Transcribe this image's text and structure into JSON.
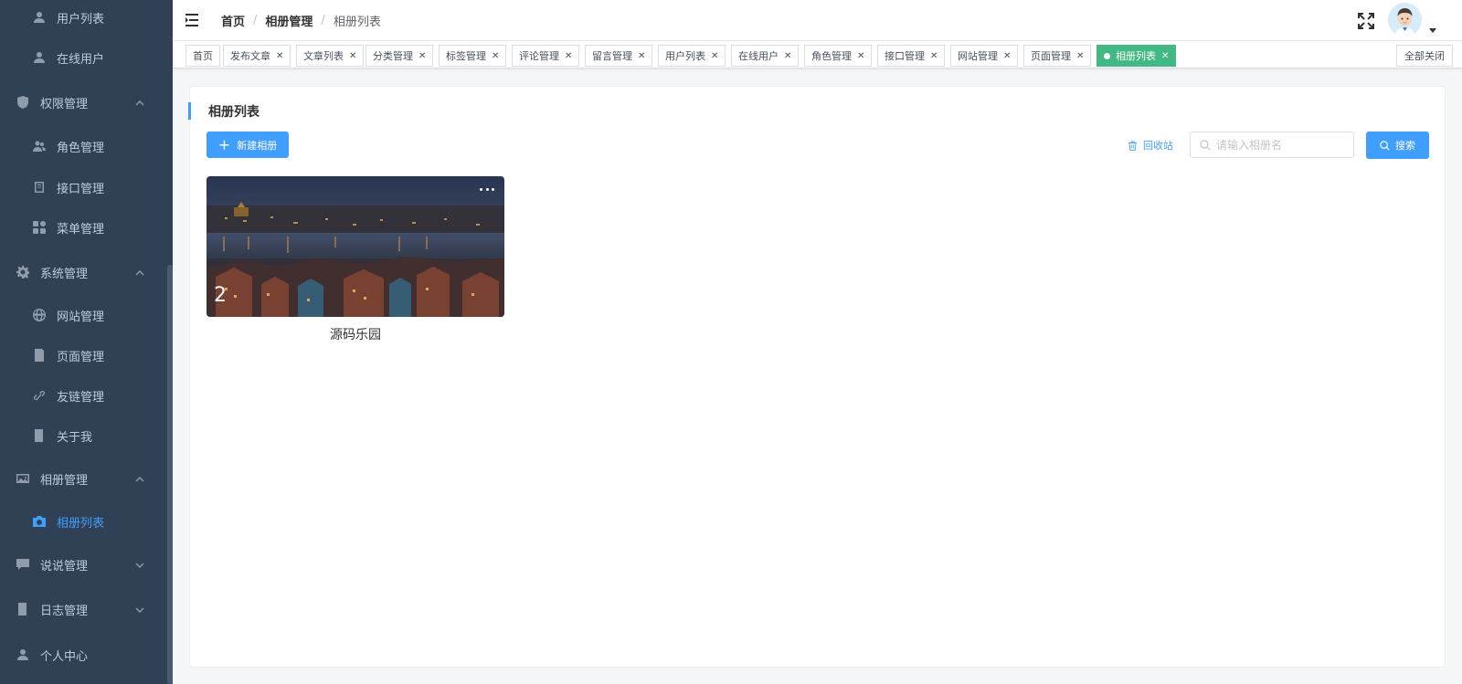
{
  "sidebar": {
    "items": [
      {
        "label": "用户列表",
        "icon": "user-icon",
        "level": "sub"
      },
      {
        "label": "在线用户",
        "icon": "user-icon",
        "level": "sub"
      },
      {
        "label": "权限管理",
        "icon": "shield-icon",
        "level": "top",
        "expanded": true
      },
      {
        "label": "角色管理",
        "icon": "users-icon",
        "level": "sub"
      },
      {
        "label": "接口管理",
        "icon": "api-icon",
        "level": "sub"
      },
      {
        "label": "菜单管理",
        "icon": "grid-icon",
        "level": "sub"
      },
      {
        "label": "系统管理",
        "icon": "gear-icon",
        "level": "top",
        "expanded": true
      },
      {
        "label": "网站管理",
        "icon": "globe-icon",
        "level": "sub"
      },
      {
        "label": "页面管理",
        "icon": "page-icon",
        "level": "sub"
      },
      {
        "label": "友链管理",
        "icon": "link-icon",
        "level": "sub"
      },
      {
        "label": "关于我",
        "icon": "book-icon",
        "level": "sub"
      },
      {
        "label": "相册管理",
        "icon": "image-icon",
        "level": "top",
        "expanded": true
      },
      {
        "label": "相册列表",
        "icon": "camera-icon",
        "level": "sub",
        "active": true
      },
      {
        "label": "说说管理",
        "icon": "chat-icon",
        "level": "top",
        "expanded": false
      },
      {
        "label": "日志管理",
        "icon": "log-icon",
        "level": "top",
        "expanded": false
      },
      {
        "label": "个人中心",
        "icon": "user-icon",
        "level": "top"
      }
    ]
  },
  "navbar": {
    "breadcrumb": [
      "首页",
      "相册管理",
      "相册列表"
    ],
    "separator": "/"
  },
  "tags": [
    {
      "label": "首页",
      "closable": false
    },
    {
      "label": "发布文章",
      "closable": true
    },
    {
      "label": "文章列表",
      "closable": true
    },
    {
      "label": "分类管理",
      "closable": true
    },
    {
      "label": "标签管理",
      "closable": true
    },
    {
      "label": "评论管理",
      "closable": true
    },
    {
      "label": "留言管理",
      "closable": true
    },
    {
      "label": "用户列表",
      "closable": true
    },
    {
      "label": "在线用户",
      "closable": true
    },
    {
      "label": "角色管理",
      "closable": true
    },
    {
      "label": "接口管理",
      "closable": true
    },
    {
      "label": "网站管理",
      "closable": true
    },
    {
      "label": "页面管理",
      "closable": true
    },
    {
      "label": "相册列表",
      "closable": true,
      "active": true
    }
  ],
  "tags_close_all": "全部关闭",
  "main": {
    "title": "相册列表",
    "new_button": "新建相册",
    "recycle_label": "回收站",
    "search_placeholder": "请输入相册名",
    "search_button": "搜索",
    "albums": [
      {
        "name": "源码乐园",
        "count": "2"
      }
    ]
  },
  "colors": {
    "sidebar_bg": "#304156",
    "primary": "#409eff",
    "active_tag": "#42b983"
  }
}
